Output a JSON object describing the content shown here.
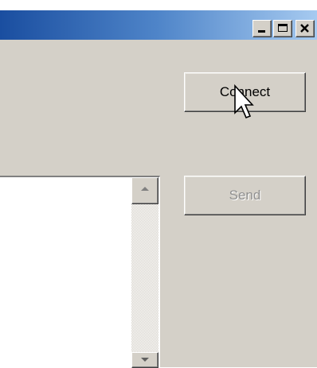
{
  "titlebar": {
    "buttons": [
      "minimize",
      "maximize",
      "close"
    ]
  },
  "actions": {
    "connect_label": "Connect",
    "send_label": "Send"
  },
  "icons": {
    "minimize": "minimize-icon",
    "maximize": "maximize-icon",
    "close": "close-icon",
    "scroll_up": "scroll-up-arrow-icon",
    "scroll_down": "scroll-down-arrow-icon",
    "cursor": "mouse-pointer-icon"
  },
  "state": {
    "send_enabled": false
  },
  "colors": {
    "window_face": "#d4d0c8",
    "titlebar_start": "#1a4ea0",
    "titlebar_end": "#a6caf0",
    "disabled_text": "#8f8f8f"
  }
}
